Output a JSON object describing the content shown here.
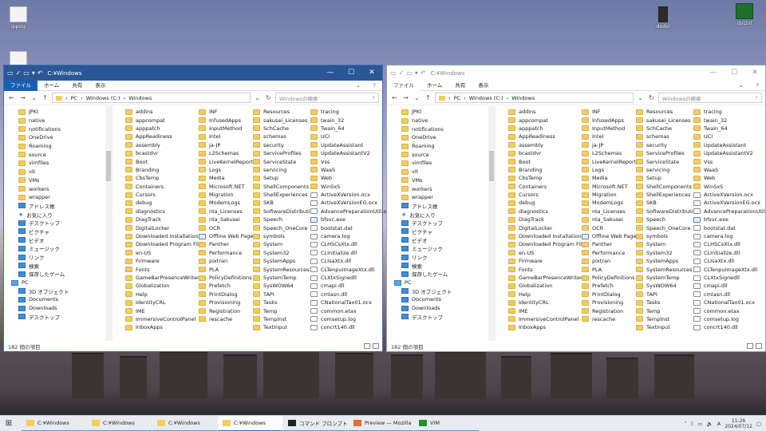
{
  "desktop": {
    "icons": [
      {
        "label": "ippsig",
        "icon": "file-icon"
      },
      {
        "label": "",
        "icon": "file-icon"
      },
      {
        "label": "dodvi",
        "icon": "app-icon"
      },
      {
        "label": "dvi2vl",
        "icon": "vim-icon"
      }
    ]
  },
  "explorer_left": {
    "title": "C:¥Windows",
    "quick_access_glyphs": [
      "▾",
      "↶"
    ],
    "ribbon_tabs": [
      "ファイル",
      "ホーム",
      "共有",
      "表示"
    ],
    "address": [
      "PC",
      "Windows (C:)",
      "Windows"
    ],
    "search_placeholder": "Windowsの検索",
    "status": "182 個の項目"
  },
  "explorer_right": {
    "title": "C:¥Windows",
    "quick_access_glyphs": [
      "▾",
      "↶"
    ],
    "ribbon_tabs": [
      "ファイル",
      "ホーム",
      "共有",
      "表示"
    ],
    "address": [
      "PC",
      "Windows (C:)",
      "Windows"
    ],
    "search_placeholder": "Windowsの検索",
    "status": "182 個の項目"
  },
  "nav_items": [
    {
      "label": "JPKI",
      "icon": "folder-icon",
      "root": false
    },
    {
      "label": "native",
      "icon": "folder-icon",
      "root": false
    },
    {
      "label": "notifications",
      "icon": "folder-icon",
      "root": false
    },
    {
      "label": "OneDrive",
      "icon": "folder-icon",
      "root": false
    },
    {
      "label": "Roaming",
      "icon": "folder-icon",
      "root": false
    },
    {
      "label": "source",
      "icon": "folder-icon",
      "root": false
    },
    {
      "label": "vimfiles",
      "icon": "folder-icon",
      "root": false
    },
    {
      "label": "vit",
      "icon": "folder-icon",
      "root": false
    },
    {
      "label": "VMs",
      "icon": "folder-icon",
      "root": false
    },
    {
      "label": "workers",
      "icon": "folder-icon",
      "root": false
    },
    {
      "label": "wrapper",
      "icon": "folder-icon",
      "root": false
    },
    {
      "label": "アドレス帳",
      "icon": "contacts-icon",
      "root": false
    },
    {
      "label": "お気に入り",
      "icon": "star-icon",
      "root": false
    },
    {
      "label": "デスクトップ",
      "icon": "desktop-icon",
      "root": false
    },
    {
      "label": "ピクチャ",
      "icon": "pictures-icon",
      "root": false
    },
    {
      "label": "ビデオ",
      "icon": "videos-icon",
      "root": false
    },
    {
      "label": "ミュージック",
      "icon": "music-icon",
      "root": false
    },
    {
      "label": "リンク",
      "icon": "links-icon",
      "root": false
    },
    {
      "label": "検索",
      "icon": "search-icon",
      "root": false
    },
    {
      "label": "保存したゲーム",
      "icon": "games-icon",
      "root": false
    },
    {
      "label": "PC",
      "icon": "pc-icon",
      "root": true
    },
    {
      "label": "3D オブジェクト",
      "icon": "3d-objects-icon",
      "root": false
    },
    {
      "label": "Documents",
      "icon": "documents-icon",
      "root": false
    },
    {
      "label": "Downloads",
      "icon": "downloads-icon",
      "root": false
    },
    {
      "label": "デスクトップ",
      "icon": "desktop-icon",
      "root": false
    }
  ],
  "file_columns": [
    [
      "addins",
      "appcompat",
      "apppatch",
      "AppReadiness",
      "assembly",
      "bcastdvr",
      "Boot",
      "Branding",
      "CbsTemp",
      "Containers",
      "Cursors",
      "debug",
      "diagnostics",
      "DiagTrack",
      "DigitalLocker",
      "Downloaded Installations",
      "Downloaded Program Files",
      "en-US",
      "Firmware",
      "Fonts",
      "GameBarPresenceWriter",
      "Globalization",
      "Help",
      "IdentityCRL",
      "IME",
      "ImmersiveControlPanel",
      "InboxApps"
    ],
    [
      "INF",
      "InfusedApps",
      "InputMethod",
      "Intel",
      "ja-JP",
      "L2Schemas",
      "LiveKernelReports",
      "Logs",
      "Media",
      "Microsoft.NET",
      "Migration",
      "ModemLogs",
      "nta_Licenses",
      "nta_Sakusei",
      "OCR",
      "Offline Web Pages",
      "Panther",
      "Performance",
      "pixtran",
      "PLA",
      "PolicyDefinitions",
      "Prefetch",
      "PrintDialog",
      "Provisioning",
      "Registration",
      "rescache"
    ],
    [
      "Resources",
      "sakusei_Licenses",
      "SchCache",
      "schemas",
      "security",
      "ServiceProfiles",
      "ServiceState",
      "servicing",
      "Setup",
      "ShellComponents",
      "ShellExperiences",
      "SKB",
      "SoftwareDistribution",
      "Speech",
      "Speech_OneCore",
      "symbols",
      "System",
      "System32",
      "SystemApps",
      "SystemResources",
      "SystemTemp",
      "SysWOW64",
      "TAPI",
      "Tasks",
      "Temp",
      "TempInst",
      "TextInput"
    ],
    [
      "tracing",
      "twain_32",
      "Twain_64",
      "UCI",
      "UpdateAssistant",
      "UpdateAssistantV2",
      "Vss",
      "WaaS",
      "Web",
      "WinSxS",
      "ActiveXVersion.ocx",
      "ActiveXVersionEG.ocx",
      "AdvancePreparationUtil.ocx",
      "bfsvc.exe",
      "bootstat.dat",
      "camera.log",
      "CLHSCsXtx.dll",
      "CLInitialize.dll",
      "CLIsaXtx.dll",
      "CLTenpuImageXtx.dll",
      "CLXtxSignedll",
      "cmapi.dll",
      "cmlasn.dll",
      "CNationalTax01.ocx",
      "common.etax",
      "comsetup.log",
      "concrt140.dll"
    ]
  ],
  "file_kinds": [
    [
      "d",
      "d",
      "d",
      "d",
      "d",
      "d",
      "d",
      "d",
      "d",
      "d",
      "d",
      "d",
      "d",
      "d",
      "d",
      "d",
      "d",
      "d",
      "d",
      "d",
      "d",
      "d",
      "d",
      "d",
      "d",
      "d",
      "d"
    ],
    [
      "d",
      "d",
      "d",
      "d",
      "d",
      "d",
      "d",
      "d",
      "d",
      "d",
      "d",
      "d",
      "d",
      "d",
      "d",
      "w",
      "d",
      "d",
      "d",
      "d",
      "d",
      "d",
      "d",
      "d",
      "d",
      "d"
    ],
    [
      "d",
      "d",
      "d",
      "d",
      "d",
      "d",
      "d",
      "d",
      "d",
      "d",
      "d",
      "d",
      "d",
      "d",
      "d",
      "d",
      "d",
      "d",
      "d",
      "d",
      "d",
      "d",
      "d",
      "d",
      "d",
      "d",
      "d"
    ],
    [
      "d",
      "d",
      "d",
      "d",
      "d",
      "d",
      "d",
      "d",
      "d",
      "d",
      "f",
      "f",
      "f",
      "e",
      "f",
      "f",
      "f",
      "f",
      "f",
      "f",
      "f",
      "f",
      "f",
      "f",
      "f",
      "f",
      "f"
    ]
  ],
  "taskbar": {
    "start_icon": "windows-icon",
    "items": [
      {
        "label": "C:¥Windows",
        "icon": "folder-icon",
        "active": false
      },
      {
        "label": "C:¥Windows",
        "icon": "folder-icon",
        "active": false
      },
      {
        "label": "C:¥Windows",
        "icon": "folder-icon",
        "active": false
      },
      {
        "label": "C:¥Windows",
        "icon": "folder-icon",
        "active": true
      },
      {
        "label": "コマンド プロンプト",
        "icon": "cmd-icon",
        "active": false
      },
      {
        "label": "Preview — Mozilla ...",
        "icon": "firefox-icon",
        "active": false
      },
      {
        "label": "VIM",
        "icon": "vim-icon",
        "active": false
      }
    ],
    "tray_ime": "A",
    "time": "11:26",
    "date": "2024/07/12"
  },
  "colors": {
    "titlebar_active": "#2b5797",
    "file_tab": "#1b5fb4",
    "folder": "#f3cd5e"
  }
}
